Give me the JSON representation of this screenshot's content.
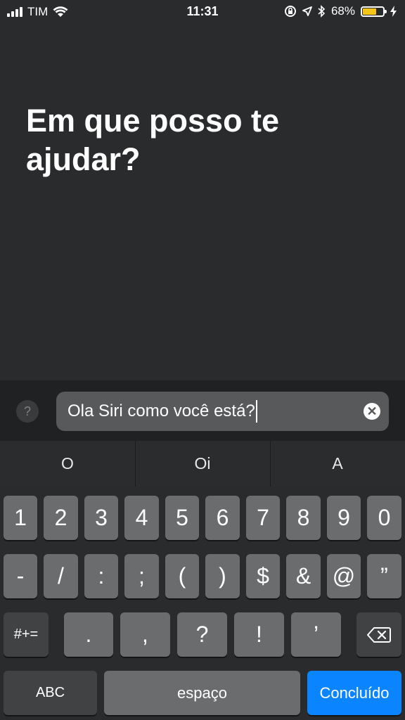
{
  "status": {
    "carrier": "TIM",
    "time": "11:31",
    "battery": "68%",
    "battery_level": 0.68,
    "icons": [
      "signal-icon",
      "wifi-icon",
      "orientation-lock-icon",
      "location-icon",
      "bluetooth-icon",
      "battery-icon",
      "charging-icon"
    ]
  },
  "siri": {
    "prompt": "Em que posso te ajudar?"
  },
  "input": {
    "help_label": "?",
    "value": "Ola Siri como você está?",
    "clear_label": "✕"
  },
  "suggestions": [
    "O",
    "Oi",
    "A"
  ],
  "keyboard": {
    "row1": [
      "1",
      "2",
      "3",
      "4",
      "5",
      "6",
      "7",
      "8",
      "9",
      "0"
    ],
    "row2": [
      "-",
      "/",
      ":",
      ";",
      "(",
      ")",
      "$",
      "&",
      "@",
      "”"
    ],
    "row3": [
      ".",
      ",",
      "?",
      "!",
      "’"
    ],
    "symbols_label": "#+=",
    "abc_label": "ABC",
    "space_label": "espaço",
    "done_label": "Concluído",
    "colors": {
      "key": "#6b6c6e",
      "dark_key": "#414244",
      "done": "#0a84ff"
    }
  }
}
